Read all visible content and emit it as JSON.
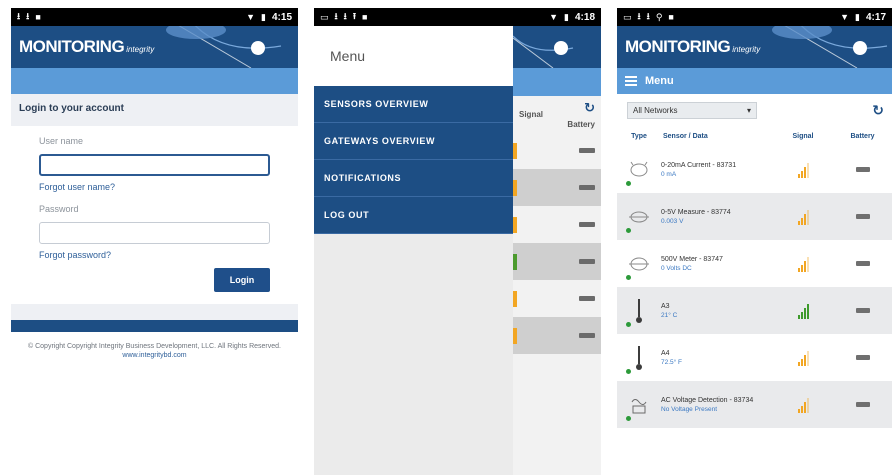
{
  "status_bar": {
    "time_1": "4:15",
    "time_2": "4:18",
    "time_3": "4:17"
  },
  "brand": {
    "logo_text": "MONITORING",
    "logo_sub": "integrity"
  },
  "login_screen": {
    "heading": "Login to your account",
    "username_label": "User name",
    "forgot_username": "Forgot user name?",
    "password_label": "Password",
    "forgot_password": "Forgot password?",
    "login_button": "Login",
    "copyright": "© Copyright Copyright Integrity Business Development, LLC. All Rights Reserved.",
    "website": "www.integritybd.com"
  },
  "menu_screen": {
    "title": "Menu",
    "items": [
      {
        "label": "SENSORS OVERVIEW"
      },
      {
        "label": "GATEWAYS OVERVIEW"
      },
      {
        "label": "NOTIFICATIONS"
      },
      {
        "label": "LOG OUT"
      }
    ],
    "behind_header": {
      "signal": "Signal",
      "battery": "Battery"
    }
  },
  "sensors_screen": {
    "menu_label": "Menu",
    "network_select": "All Networks",
    "columns": {
      "type": "Type",
      "sensor": "Sensor / Data",
      "signal": "Signal",
      "battery": "Battery"
    },
    "rows": [
      {
        "name": "0-20mA Current - 83731",
        "data": "0 mA",
        "signal": "medium",
        "icon": "current-sensor-icon"
      },
      {
        "name": "0-5V Measure - 83774",
        "data": "0.003 V",
        "signal": "medium",
        "icon": "voltage-sensor-icon"
      },
      {
        "name": "500V Meter - 83747",
        "data": "0 Volts DC",
        "signal": "medium",
        "icon": "volt-meter-icon"
      },
      {
        "name": "A3",
        "data": "21° C",
        "signal": "full",
        "icon": "thermometer-icon"
      },
      {
        "name": "A4",
        "data": "72.5° F",
        "signal": "medium",
        "icon": "thermometer-icon"
      },
      {
        "name": "AC Voltage Detection - 83734",
        "data": "No Voltage Present",
        "signal": "medium",
        "icon": "ac-voltage-icon"
      }
    ]
  },
  "colors": {
    "brand_navy": "#1d4e84",
    "header_blue": "#5b9bd8",
    "signal_amber": "#f2a623",
    "signal_green": "#3e9a2c"
  }
}
